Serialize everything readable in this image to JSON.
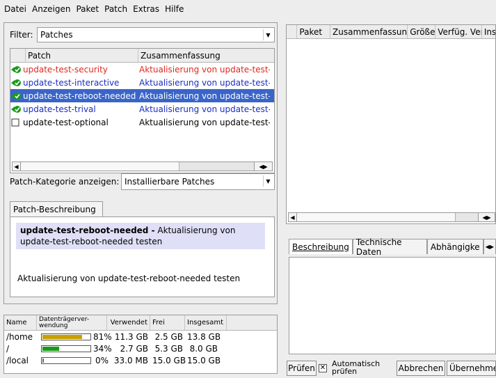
{
  "menu": [
    "Datei",
    "Anzeigen",
    "Paket",
    "Patch",
    "Extras",
    "Hilfe"
  ],
  "filter": {
    "label": "Filter:",
    "value": "Patches"
  },
  "patch_list": {
    "columns": [
      "Patch",
      "Zusammenfassung"
    ],
    "rows": [
      {
        "name": "update-test-security",
        "summary": "Aktualisierung von update-test-s",
        "color": "#e0281e",
        "status_icon": "security-patch-icon",
        "selected": false
      },
      {
        "name": "update-test-interactive",
        "summary": "Aktualisierung von update-test-in",
        "color": "#1a2ec0",
        "status_icon": "install-patch-icon",
        "selected": false
      },
      {
        "name": "update-test-reboot-needed",
        "summary": "Aktualisierung von update-test-re",
        "color": "#ffffff",
        "status_icon": "install-patch-icon",
        "selected": true
      },
      {
        "name": "update-test-trival",
        "summary": "Aktualisierung von update-test-tri",
        "color": "#1a2ec0",
        "status_icon": "install-patch-icon",
        "selected": false
      },
      {
        "name": "update-test-optional",
        "summary": "Aktualisierung von update-test-o",
        "color": "#000000",
        "status_icon": "checkbox-icon",
        "selected": false
      }
    ]
  },
  "patch_category": {
    "label": "Patch-Kategorie anzeigen:",
    "value": "Installierbare Patches"
  },
  "description": {
    "tab": "Patch-Beschreibung",
    "title": "update-test-reboot-needed -",
    "title_rest": " Aktualisierung von update-test-reboot-needed testen",
    "body": "Aktualisierung von update-test-reboot-needed testen"
  },
  "disk_usage": {
    "columns": [
      "Name",
      "Datenträgerver-wendung",
      "Verwendet",
      "Frei",
      "Insgesamt"
    ],
    "rows": [
      {
        "name": "/home",
        "percent": 81,
        "percent_label": "81%",
        "used": "11.3 GB",
        "free": "2.5 GB",
        "total": "13.8 GB",
        "bar_color": "#c8a000"
      },
      {
        "name": "/",
        "percent": 34,
        "percent_label": "34%",
        "used": "2.7 GB",
        "free": "5.3 GB",
        "total": "8.0 GB",
        "bar_color": "#1a9a1a"
      },
      {
        "name": "/local",
        "percent": 0,
        "percent_label": "0%",
        "used": "33.0 MB",
        "free": "15.0 GB",
        "total": "15.0 GB",
        "bar_color": "#1a9a1a"
      }
    ]
  },
  "package_list": {
    "columns": [
      "Paket",
      "Zusammenfassung",
      "Größe",
      "Verfüg. Ver.",
      "Ins"
    ]
  },
  "detail_tabs": [
    "Beschreibung",
    "Technische Daten",
    "Abhängigke"
  ],
  "bottom": {
    "check_button": "Prüfen",
    "auto_check": "Automatisch prüfen",
    "cancel": "Abbrechen",
    "accept": "Übernehmen"
  }
}
